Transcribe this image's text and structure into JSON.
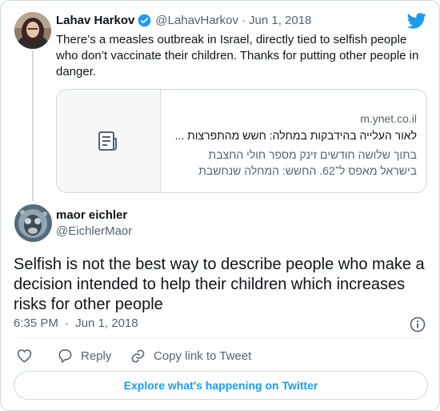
{
  "colors": {
    "accent": "#1d9bf0",
    "secondary_text": "#536471",
    "border": "#cfd9de"
  },
  "quoted_tweet": {
    "author_name": "Lahav Harkov",
    "handle": "@LahavHarkov",
    "separator": "·",
    "date": "Jun 1, 2018",
    "text": "There’s a measles outbreak in Israel, directly tied to selfish people who don’t vaccinate their children. Thanks for putting other people in danger.",
    "link_card": {
      "domain": "m.ynet.co.il",
      "title": "לאור העלייה בהידבקות במחלה: חשש מהתפרצות ...",
      "description_line1": "בתוך שלושה חודשים זינק מספר חולי החצבת",
      "description_line2": "בישראל מאפס ל־62. החשש: המחלה שנחשבת",
      "thumb_icon": "article-icon"
    }
  },
  "reply_tweet": {
    "author_name": "maor eichler",
    "handle": "@EichlerMaor",
    "text": "Selfish is not the best way to describe people who make a decision intended to help their children which increases risks for other people",
    "time": "6:35 PM",
    "separator": "·",
    "date": "Jun 1, 2018"
  },
  "actions": {
    "like_icon": "heart-icon",
    "reply_label": "Reply",
    "copy_link_label": "Copy link to Tweet"
  },
  "explore_label": "Explore what's happening on Twitter"
}
